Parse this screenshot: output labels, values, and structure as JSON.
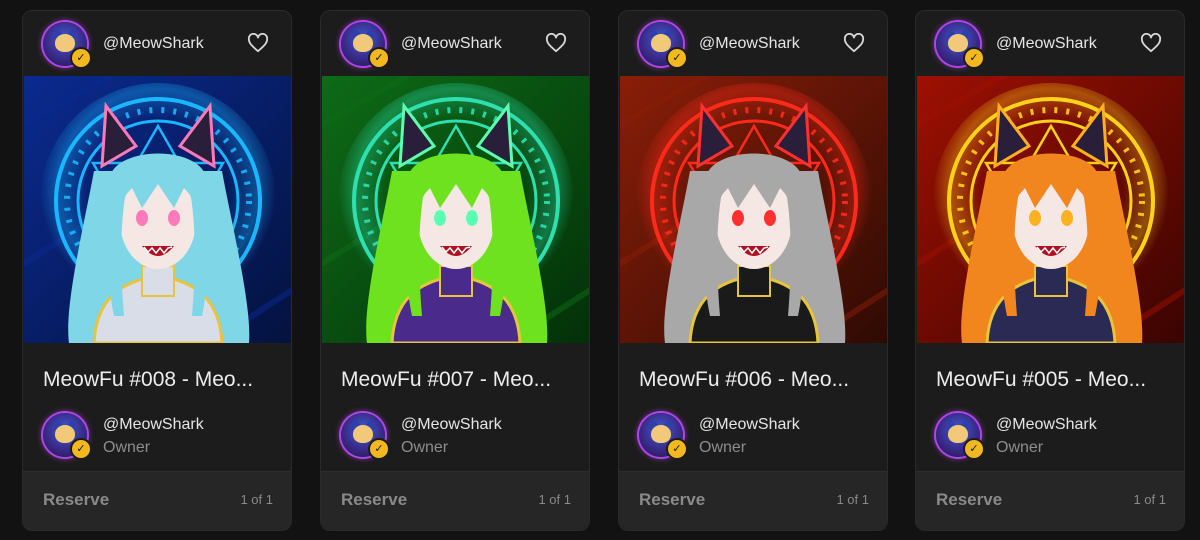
{
  "cards": [
    {
      "handle": "@MeowShark",
      "title": "MeowFu #008 - Meo...",
      "owner_name": "@MeowShark",
      "owner_role": "Owner",
      "action": "Reserve",
      "edition": "1 of 1",
      "colors": {
        "bg1": "#0a2a8f",
        "bg2": "#04123f",
        "glow": "#19b7ff",
        "hair": "#7fd6e6",
        "suit": "#d9dde8",
        "eye": "#ff7ab8"
      }
    },
    {
      "handle": "@MeowShark",
      "title": "MeowFu #007 - Meo...",
      "owner_name": "@MeowShark",
      "owner_role": "Owner",
      "action": "Reserve",
      "edition": "1 of 1",
      "colors": {
        "bg1": "#0d6b17",
        "bg2": "#033008",
        "glow": "#2de0b0",
        "hair": "#6fe21f",
        "suit": "#4a2a8a",
        "eye": "#5cffb0"
      }
    },
    {
      "handle": "@MeowShark",
      "title": "MeowFu #006 - Meo...",
      "owner_name": "@MeowShark",
      "owner_role": "Owner",
      "action": "Reserve",
      "edition": "1 of 1",
      "colors": {
        "bg1": "#8a1e08",
        "bg2": "#2e0a03",
        "glow": "#ff2a1a",
        "hair": "#a8a8a8",
        "suit": "#1a1a1a",
        "eye": "#ff3030"
      }
    },
    {
      "handle": "@MeowShark",
      "title": "MeowFu #005 - Meo...",
      "owner_name": "@MeowShark",
      "owner_role": "Owner",
      "action": "Reserve",
      "edition": "1 of 1",
      "colors": {
        "bg1": "#9e1002",
        "bg2": "#3a0401",
        "glow": "#ffd21a",
        "hair": "#f2861e",
        "suit": "#2a2a55",
        "eye": "#ffb020"
      }
    }
  ]
}
